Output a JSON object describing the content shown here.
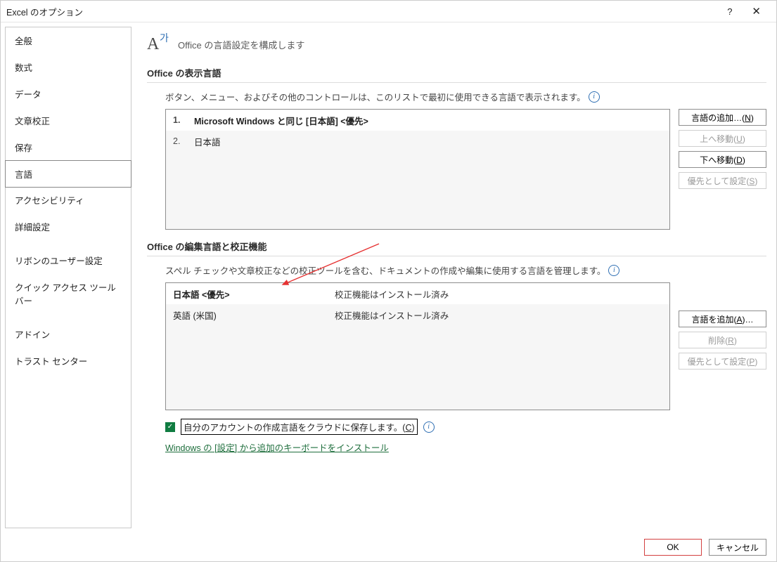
{
  "window": {
    "title": "Excel のオプション"
  },
  "titlebar": {
    "help": "?",
    "close": "✕"
  },
  "sidebar": {
    "items": [
      {
        "label": "全般"
      },
      {
        "label": "数式"
      },
      {
        "label": "データ"
      },
      {
        "label": "文章校正"
      },
      {
        "label": "保存"
      },
      {
        "label": "言語",
        "selected": true
      },
      {
        "label": "アクセシビリティ"
      },
      {
        "label": "詳細設定"
      },
      {
        "label": "リボンのユーザー設定"
      },
      {
        "label": "クイック アクセス ツール バー"
      },
      {
        "label": "アドイン"
      },
      {
        "label": "トラスト センター"
      }
    ]
  },
  "heading": "Office の言語設定を構成します",
  "display": {
    "section_title": "Office の表示言語",
    "desc": "ボタン、メニュー、およびその他のコントロールは、このリストで最初に使用できる言語で表示されます。",
    "rows": [
      {
        "num": "1.",
        "text": "Microsoft Windows と同じ [日本語] <優先>",
        "selected": true
      },
      {
        "num": "2.",
        "text": "日本語",
        "selected": false
      }
    ],
    "buttons": {
      "add": {
        "label": "言語の追加…",
        "hotkey": "N",
        "enabled": true
      },
      "up": {
        "label": "上へ移動",
        "hotkey": "U",
        "enabled": false
      },
      "down": {
        "label": "下へ移動",
        "hotkey": "D",
        "enabled": true
      },
      "priority": {
        "label": "優先として設定",
        "hotkey": "S",
        "enabled": false
      }
    }
  },
  "editing": {
    "section_title": "Office の編集言語と校正機能",
    "desc": "スペル チェックや文章校正などの校正ツールを含む、ドキュメントの作成や編集に使用する言語を管理します。",
    "rows": [
      {
        "lang": "日本語 <優先>",
        "status": "校正機能はインストール済み",
        "selected": true
      },
      {
        "lang": "英語 (米国)",
        "status": "校正機能はインストール済み",
        "selected": false
      }
    ],
    "buttons": {
      "add": {
        "label": "言語を追加",
        "hotkey": "A",
        "suffix": "…",
        "enabled": true
      },
      "remove": {
        "label": "削除",
        "hotkey": "R",
        "enabled": false
      },
      "priority": {
        "label": "優先として設定",
        "hotkey": "P",
        "enabled": false
      }
    }
  },
  "cloud": {
    "checked": true,
    "label": "自分のアカウントの作成言語をクラウドに保存します。",
    "hotkey": "C"
  },
  "link": {
    "label": "Windows の [設定] から追加のキーボードをインストール"
  },
  "footer": {
    "ok": "OK",
    "cancel": "キャンセル"
  }
}
